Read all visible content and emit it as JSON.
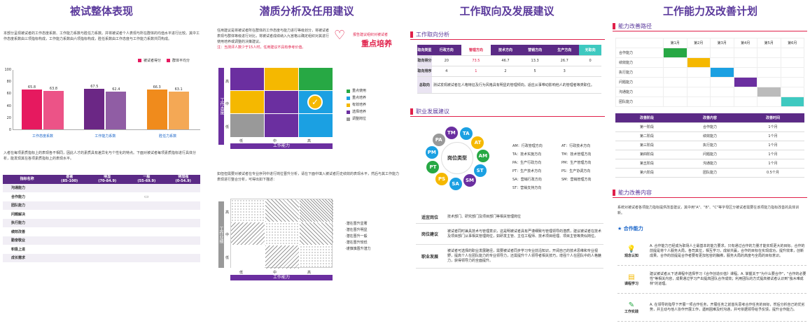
{
  "p1": {
    "title": "被试整体表现",
    "intro": "本部分呈现被试者的工作态度系数、工作能力系数与胜任力系数。并将被试者个人表现与所在群体的均值水平进行比较。其中工作态度系数由三项指标构成，工作能力系数由六项指标构成，胜任系数由工作态度与工作能力系数共同构成。",
    "legend": {
      "self": "被试者得分",
      "group": "群体平均分"
    },
    "yticks": [
      "100",
      "80",
      "60",
      "40",
      "20",
      "0"
    ],
    "chart_data": {
      "type": "bar",
      "categories": [
        "工作态度系数",
        "工作能力系数",
        "胜任力系数"
      ],
      "series": [
        {
          "name": "被试者得分",
          "values": [
            65.8,
            67.5,
            66.3
          ]
        },
        {
          "name": "群体平均分",
          "values": [
            63.8,
            62.4,
            63.1
          ]
        }
      ],
      "ylim": [
        0,
        100
      ],
      "colors": [
        "#e6195f",
        "#6b2785",
        "#f08b1c"
      ]
    },
    "bar_labels": {
      "s": [
        "65.8",
        "67.5",
        "66.3"
      ],
      "g": [
        "63.8",
        "62.4",
        "63.1"
      ]
    },
    "desc": "入者在每项素质指标上的表现各不相同，因此人才的素质具有差异化与个性化的特点。下面对被试者每项素质指标进行具体分析，能发现其在各项素质指标上的表现水平。",
    "table": {
      "headers": [
        [
          "指标名称",
          ""
        ],
        [
          "甚著",
          "(85-100)"
        ],
        [
          "明显",
          "(70-84.9)"
        ],
        [
          "一般",
          "(55-69.9)"
        ],
        [
          "待加强",
          "(0-54.9)"
        ]
      ],
      "rows": [
        "沟通能力",
        "合作能力",
        "团队能力",
        "问题解决",
        "执行能力",
        "绩效改善",
        "勤奋敬业",
        "积极上进",
        "成长需求"
      ],
      "marks": [
        2,
        3,
        2,
        null,
        null,
        null,
        null,
        null,
        null
      ]
    }
  },
  "p2": {
    "title": "潜质分析及任用建议",
    "text1": "任用建议是将被试者所在群体的工作态度与能力进行等级划分，将被试者表现与群体等级进行对比，将被试者成绩纳入九宫格以确定组织对其进行使用培养或调整的决策建议。",
    "text1red": "注：当测评人数少于15人时，任用建议不具有参考价值。",
    "badge_top": "报告建议组织对被试者",
    "badge_main": "重点培养",
    "yaxis": "工作态度",
    "xaxis": "工作能力",
    "ylev": [
      "高",
      "中",
      "低"
    ],
    "xlev": [
      "低",
      "中",
      "高"
    ],
    "legend": [
      {
        "label": "重点使用",
        "color": "#27a844"
      },
      {
        "label": "重点培养",
        "color": "#1ba0e2"
      },
      {
        "label": "有效培养",
        "color": "#f5b800"
      },
      {
        "label": "选择培养",
        "color": "#6b2fa0"
      },
      {
        "label": "调整岗位",
        "color": "#999999"
      }
    ],
    "text2": "如但但需要对被试者在专业序列中进行岗位晋升分析，请在下面中填入被试者历史绩效的表现水平，然后与其工作能力表现进行整合分析，可得出如下描述：",
    "legend2": [
      "·潜在晋升显著",
      "·潜在晋升明显",
      "·潜在晋升一般",
      "·潜在晋升较低",
      "·谨慎慎晋升潜力"
    ]
  },
  "p3": {
    "title": "工作取向及发展建议",
    "sec1": "工作取向分析",
    "ct_headers": [
      "取向类型",
      "行政方向",
      "管理方向",
      "技术方向",
      "营销方向",
      "生产方向",
      "无取向"
    ],
    "ct_rows": [
      [
        "取向得分",
        "20",
        "73.5",
        "46.7",
        "13.3",
        "26.7",
        "0"
      ],
      [
        "取向排序",
        "4",
        "1",
        "2",
        "5",
        "3",
        ""
      ]
    ],
    "ct_desc_label": "总取向",
    "ct_desc": "测试发现被试者在人格特征及行为风格具有明显的管理倾向。适应从事带动影响他人的管理者等类职位。",
    "sec2": "职业发展建议",
    "wheel_center": "岗位类型",
    "wheel": [
      "TA",
      "AT",
      "AM",
      "ST",
      "SM",
      "SA",
      "PS",
      "PT",
      "PM",
      "PA",
      "TM"
    ],
    "codes_left": [
      "AM：行政管理方向",
      "TA：技术实施方向",
      "PA：生产行政方向",
      "PT：生产技术方向",
      "SA：营销行政方向",
      "ST：营销支持方向"
    ],
    "codes_right": [
      "AT：行政技术方向",
      "TM：技术管理方向",
      "PM：生产管理方向",
      "PS：生产协调方向",
      "SM：营销管理方向"
    ],
    "rows": [
      {
        "label": "适宜岗位",
        "text": "技术部门、研究部门及项目部门等相关管理岗位"
      },
      {
        "label": "岗位建议",
        "text": "被试者同时兼具技术与管理意识，这是明被试者具有严谨细致与管理领导的潜质，建议被试者在技术及项目部门从事相关管理岗位，如研发主管、主任工程师、技术项目经理、项目主管等类似岗位。"
      },
      {
        "label": "职业发展",
        "text": "被试者可选择的职业发展路径，需要被试者同步学习专业前沿知识，开阔自己的技术思维和专业视野，提高个人在团队能力的专业领导力，还需提升个人领导者相关技巧，增强个人在团队中的人格魅力，获得领导力的全面提升。"
      }
    ]
  },
  "p4": {
    "title": "工作能力及改善计划",
    "sec1": "能力改善路径",
    "gantt_cols": [
      "第1月",
      "第2月",
      "第3月",
      "第4月",
      "第5月",
      "第6月"
    ],
    "gantt_rows": [
      {
        "label": "合作能力",
        "col": 0,
        "color": "#27a844"
      },
      {
        "label": "绩效能力",
        "col": 1,
        "color": "#f5b800"
      },
      {
        "label": "执行能力",
        "col": 2,
        "color": "#1ba0e2"
      },
      {
        "label": "问题能力",
        "col": 3,
        "color": "#6b2fa0"
      },
      {
        "label": "沟通能力",
        "col": 4,
        "color": "#bbbbbb"
      },
      {
        "label": "团队能力",
        "col": 5,
        "color": "#3ec9c0"
      }
    ],
    "plan_headers": [
      "改善阶段",
      "改善内容",
      "改善时间"
    ],
    "plan_rows": [
      [
        "第一阶段",
        "合作能力",
        "1个月"
      ],
      [
        "第二阶段",
        "绩效能力",
        "1个月"
      ],
      [
        "第三阶段",
        "执行能力",
        "1个月"
      ],
      [
        "第四阶段",
        "问题能力",
        "1个月"
      ],
      [
        "第五阶段",
        "沟通能力",
        "1个月"
      ],
      [
        "第六阶段",
        "团队能力",
        "0.5个月"
      ]
    ],
    "sec2": "能力改善内容",
    "intro": "系统对被试者各项能力指标提供改善建议，其中用\"A\"、\"B\"、\"C\"等字母区分被试者需要在该项能力指标改善的具体训新。",
    "sub": "合作能力",
    "items": [
      {
        "label": "观念认知",
        "text": "A. 合作能力已经成为职场人士最基本的能力要求，只有通过合作的力量才能实现更大的目标。合作的前提是将个人服务大局，各司其位，相互学习，成就共赢，合作的目标在实现成功，提升效率，创新成果。合作的前提是合作者要有更加包容的胸襟，服务大局的高度与全局的目标意识。"
      },
      {
        "label": "课程学习",
        "text": "建议被试者从下述课程中选择学习《合作创造价值》课程。A. 掌握关于\"为什么要合作\"，\"合作的必要性\"等相关内容，成果通过学习产出提高团队合作成效；利用团队的方式提高被试者认识到\"独木难成林\"的道理。"
      },
      {
        "label": "工作实践",
        "text": "A. 在领导的指导下开展一项合作任务，开展任务之前首先思考合作任务的目标，然后分析自己的优劣势，并主动与他人协作开展工作，遇到困难及时沟通，并可依据领导给予反馈，提升合作能力。"
      }
    ]
  }
}
